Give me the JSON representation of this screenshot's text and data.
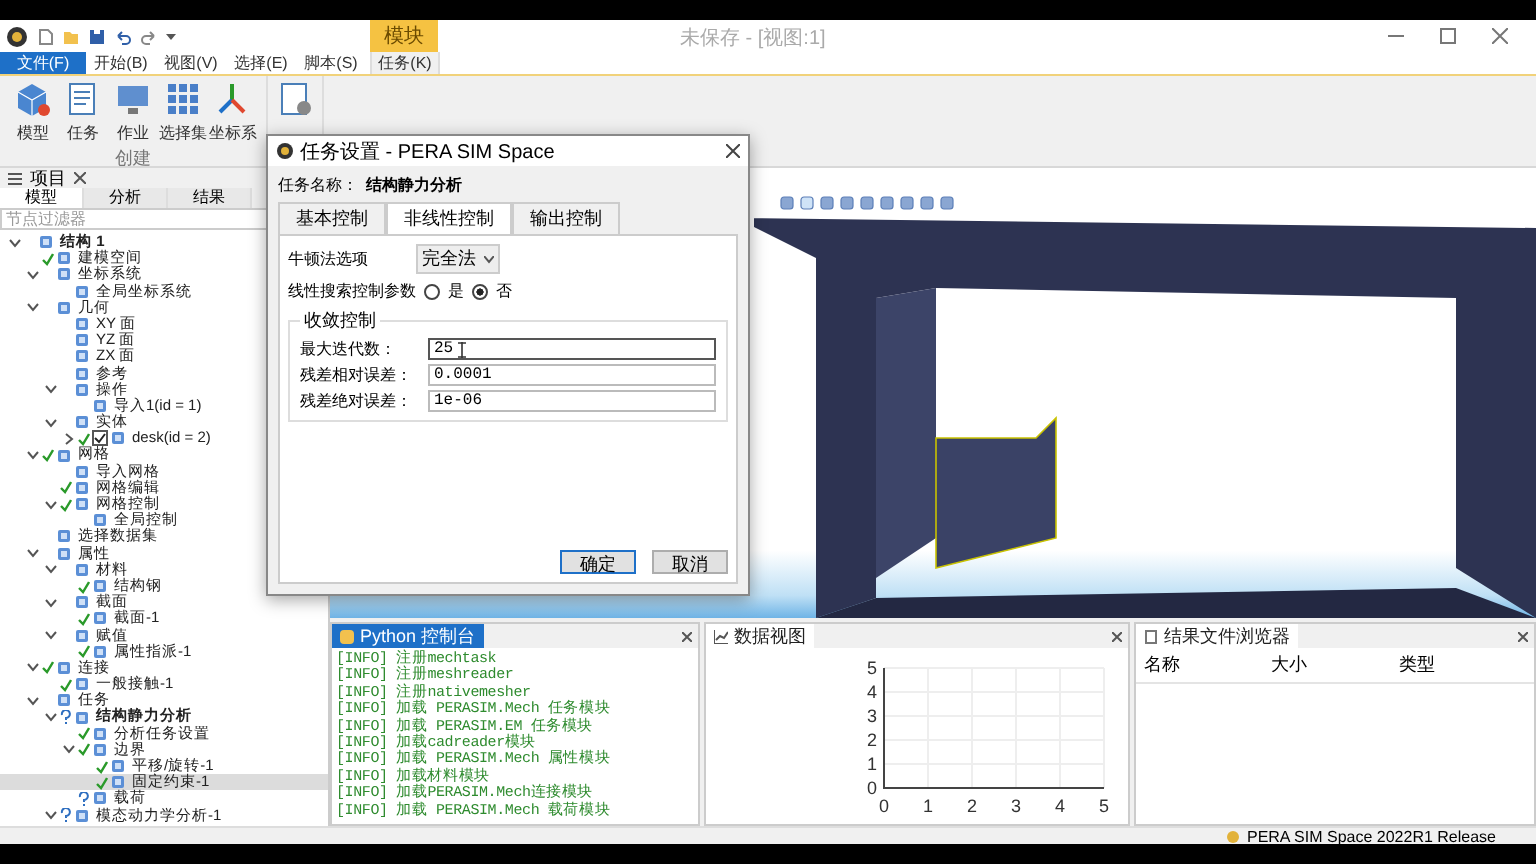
{
  "titlebar": {
    "context_tab": "模块",
    "title": "未保存 - [视图:1]"
  },
  "ribbon_tabs": [
    {
      "label": "文件(F)",
      "kind": "file",
      "selected": false
    },
    {
      "label": "开始(B)",
      "kind": "normal",
      "selected": false
    },
    {
      "label": "视图(V)",
      "kind": "normal",
      "selected": false
    },
    {
      "label": "选择(E)",
      "kind": "normal",
      "selected": false
    },
    {
      "label": "脚本(S)",
      "kind": "normal",
      "selected": false
    },
    {
      "label": "任务(K)",
      "kind": "context",
      "selected": true
    }
  ],
  "ribbon": {
    "buttons": [
      "模型",
      "任务",
      "作业",
      "选择集",
      "坐标系"
    ],
    "group_label": "创建"
  },
  "left_panel": {
    "tab": "项目",
    "subtabs": [
      {
        "label": "模型",
        "selected": true
      },
      {
        "label": "分析",
        "selected": false
      },
      {
        "label": "结果",
        "selected": false
      }
    ],
    "filter_placeholder": "节点过滤器",
    "tree": [
      {
        "label": "结构 1",
        "bold": true,
        "expanded": true,
        "selected": false,
        "children": [
          {
            "label": "建模空间",
            "valid": true,
            "selected": false
          },
          {
            "label": "坐标系统",
            "expanded": true,
            "selected": false,
            "children": [
              {
                "label": "全局坐标系统",
                "selected": false
              }
            ]
          },
          {
            "label": "几何",
            "expanded": true,
            "selected": false,
            "children": [
              {
                "label": "XY 面",
                "selected": false
              },
              {
                "label": "YZ 面",
                "selected": false
              },
              {
                "label": "ZX 面",
                "selected": false
              },
              {
                "label": "参考",
                "selected": false
              },
              {
                "label": "操作",
                "expanded": true,
                "selected": false,
                "children": [
                  {
                    "label": "导入1(id = 1)",
                    "selected": false
                  }
                ]
              },
              {
                "label": "实体",
                "expanded": true,
                "selected": false,
                "children": [
                  {
                    "label": "desk(id = 2)",
                    "expanded": false,
                    "valid": true,
                    "checkbox": true,
                    "selected": false
                  }
                ]
              }
            ]
          },
          {
            "label": "网格",
            "expanded": true,
            "valid": true,
            "selected": false,
            "children": [
              {
                "label": "导入网格",
                "selected": false
              },
              {
                "label": "网格编辑",
                "valid": true,
                "selected": false
              },
              {
                "label": "网格控制",
                "expanded": true,
                "valid": true,
                "selected": false,
                "children": [
                  {
                    "label": "全局控制",
                    "selected": false
                  }
                ]
              }
            ]
          },
          {
            "label": "选择数据集",
            "selected": false
          },
          {
            "label": "属性",
            "expanded": true,
            "selected": false,
            "children": [
              {
                "label": "材料",
                "expanded": true,
                "selected": false,
                "children": [
                  {
                    "label": "结构钢",
                    "valid": true,
                    "selected": false
                  }
                ]
              },
              {
                "label": "截面",
                "expanded": true,
                "selected": false,
                "children": [
                  {
                    "label": "截面-1",
                    "valid": true,
                    "selected": false
                  }
                ]
              },
              {
                "label": "赋值",
                "expanded": true,
                "selected": false,
                "children": [
                  {
                    "label": "属性指派-1",
                    "valid": true,
                    "selected": false
                  }
                ]
              }
            ]
          },
          {
            "label": "连接",
            "expanded": true,
            "valid": true,
            "selected": false,
            "children": [
              {
                "label": "一般接触-1",
                "valid": true,
                "selected": false
              }
            ]
          },
          {
            "label": "任务",
            "expanded": true,
            "selected": false,
            "children": [
              {
                "label": "结构静力分析",
                "bold": true,
                "expanded": true,
                "valid": false,
                "selected": false,
                "children": [
                  {
                    "label": "分析任务设置",
                    "valid": true,
                    "selected": false
                  },
                  {
                    "label": "边界",
                    "expanded": true,
                    "valid": true,
                    "selected": false,
                    "children": [
                      {
                        "label": "平移/旋转-1",
                        "valid": true,
                        "selected": false
                      },
                      {
                        "label": "固定约束-1",
                        "valid": true,
                        "selected": true
                      }
                    ]
                  },
                  {
                    "label": "载荷",
                    "valid": false,
                    "selected": false
                  }
                ]
              },
              {
                "label": "模态动力学分析-1",
                "expanded": true,
                "valid": false,
                "selected": false
              }
            ]
          }
        ]
      }
    ]
  },
  "dialog": {
    "title": "任务设置 - PERA SIM Space",
    "task_name_label": "任务名称：",
    "task_name": "结构静力分析",
    "tabs": [
      {
        "label": "基本控制",
        "selected": false
      },
      {
        "label": "非线性控制",
        "selected": true
      },
      {
        "label": "输出控制",
        "selected": false
      }
    ],
    "newton": {
      "label": "牛顿法选项",
      "value": "完全法"
    },
    "line_search": {
      "label": "线性搜索控制参数",
      "options": [
        {
          "label": "是",
          "selected": false
        },
        {
          "label": "否",
          "selected": true
        }
      ]
    },
    "group": {
      "title": "收敛控制",
      "fields": [
        {
          "label": "最大迭代数：",
          "value": "25",
          "focused": true
        },
        {
          "label": "残差相对误差：",
          "value": "0.0001",
          "focused": false
        },
        {
          "label": "残差绝对误差：",
          "value": "1e-06",
          "focused": false
        }
      ]
    },
    "buttons": [
      {
        "label": "确定",
        "default": true
      },
      {
        "label": "取消",
        "default": false
      }
    ]
  },
  "console": {
    "tab": "Python 控制台",
    "lines": [
      "[INFO] 注册mechtask",
      "[INFO] 注册meshreader",
      "[INFO] 注册nativemesher",
      "[INFO] 加载 PERASIM.Mech 任务模块",
      "[INFO] 加载 PERASIM.EM 任务模块",
      "[INFO] 加载cadreader模块",
      "[INFO] 加载 PERASIM.Mech 属性模块",
      "[INFO] 加载材料模块",
      "[INFO] 加载PERASIM.Mech连接模块",
      "[INFO] 加载 PERASIM.Mech 载荷模块"
    ]
  },
  "data_view": {
    "tab": "数据视图",
    "chart_data": {
      "type": "line",
      "grid": true,
      "xlim": [
        0,
        5
      ],
      "ylim": [
        0,
        5
      ],
      "xticks": [
        0,
        1,
        2,
        3,
        4,
        5
      ],
      "yticks": [
        0,
        1,
        2,
        3,
        4,
        5
      ]
    }
  },
  "results": {
    "title": "结果文件浏览器",
    "columns": [
      "名称",
      "大小",
      "类型"
    ]
  },
  "status_bar": {
    "text": "PERA SIM Space 2022R1 Release"
  }
}
